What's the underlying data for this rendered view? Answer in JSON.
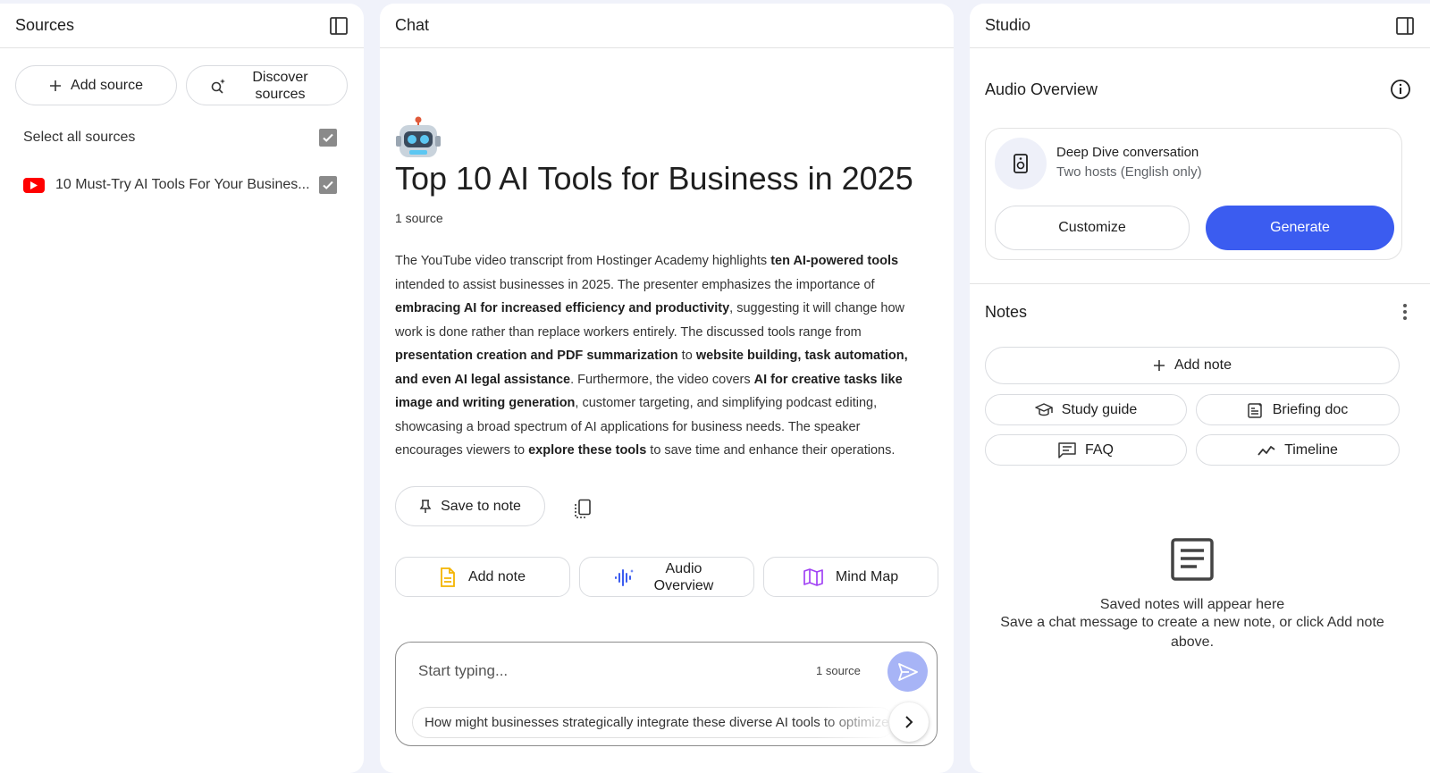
{
  "sources": {
    "title": "Sources",
    "add_source": "Add source",
    "discover_sources": "Discover sources",
    "select_all": "Select all sources",
    "items": [
      {
        "label": "10 Must-Try AI Tools For Your Busines...",
        "type": "youtube-icon",
        "checked": true
      }
    ]
  },
  "chat": {
    "title": "Chat",
    "notebook_title": "Top 10 AI Tools for Business in 2025",
    "notebook_emoji": "robot-icon",
    "source_count": "1 source",
    "summary_segments": [
      {
        "t": "The YouTube video transcript from Hostinger Academy highlights ",
        "b": false
      },
      {
        "t": "ten AI-powered tools",
        "b": true
      },
      {
        "t": " intended to assist businesses in 2025. The presenter emphasizes the importance of ",
        "b": false
      },
      {
        "t": "embracing AI for increased efficiency and productivity",
        "b": true
      },
      {
        "t": ", suggesting it will change how work is done rather than replace workers entirely. The discussed tools range from ",
        "b": false
      },
      {
        "t": "presentation creation and PDF summarization",
        "b": true
      },
      {
        "t": " to ",
        "b": false
      },
      {
        "t": "website building, task automation, and even AI legal assistance",
        "b": true
      },
      {
        "t": ". Furthermore, the video covers ",
        "b": false
      },
      {
        "t": "AI for creative tasks like image and writing generation",
        "b": true
      },
      {
        "t": ", customer targeting, and simplifying podcast editing, showcasing a broad spectrum of AI applications for business needs. The speaker encourages viewers to ",
        "b": false
      },
      {
        "t": "explore these tools",
        "b": true
      },
      {
        "t": " to save time and enhance their operations.",
        "b": false
      }
    ],
    "save_to_note": "Save to note",
    "actions": {
      "add_note": "Add note",
      "audio_overview": "Audio Overview",
      "mind_map": "Mind Map"
    },
    "composer": {
      "placeholder": "Start typing...",
      "source_count": "1 source",
      "suggestion": "How might businesses strategically integrate these diverse AI tools to optimize"
    }
  },
  "studio": {
    "title": "Studio",
    "audio_overview": "Audio Overview",
    "deep_dive_title": "Deep Dive conversation",
    "deep_dive_sub": "Two hosts (English only)",
    "customize": "Customize",
    "generate": "Generate",
    "notes_title": "Notes",
    "add_note": "Add note",
    "study_guide": "Study guide",
    "briefing_doc": "Briefing doc",
    "faq": "FAQ",
    "timeline": "Timeline",
    "empty_title": "Saved notes will appear here",
    "empty_sub": "Save a chat message to create a new note, or click Add note above."
  },
  "colors": {
    "accent": "#3b5cf0",
    "send_disabled": "#a7b4f6",
    "youtube": "#ff0000",
    "note_icon": "#f4b400",
    "mind_map_icon": "#a142f4"
  }
}
